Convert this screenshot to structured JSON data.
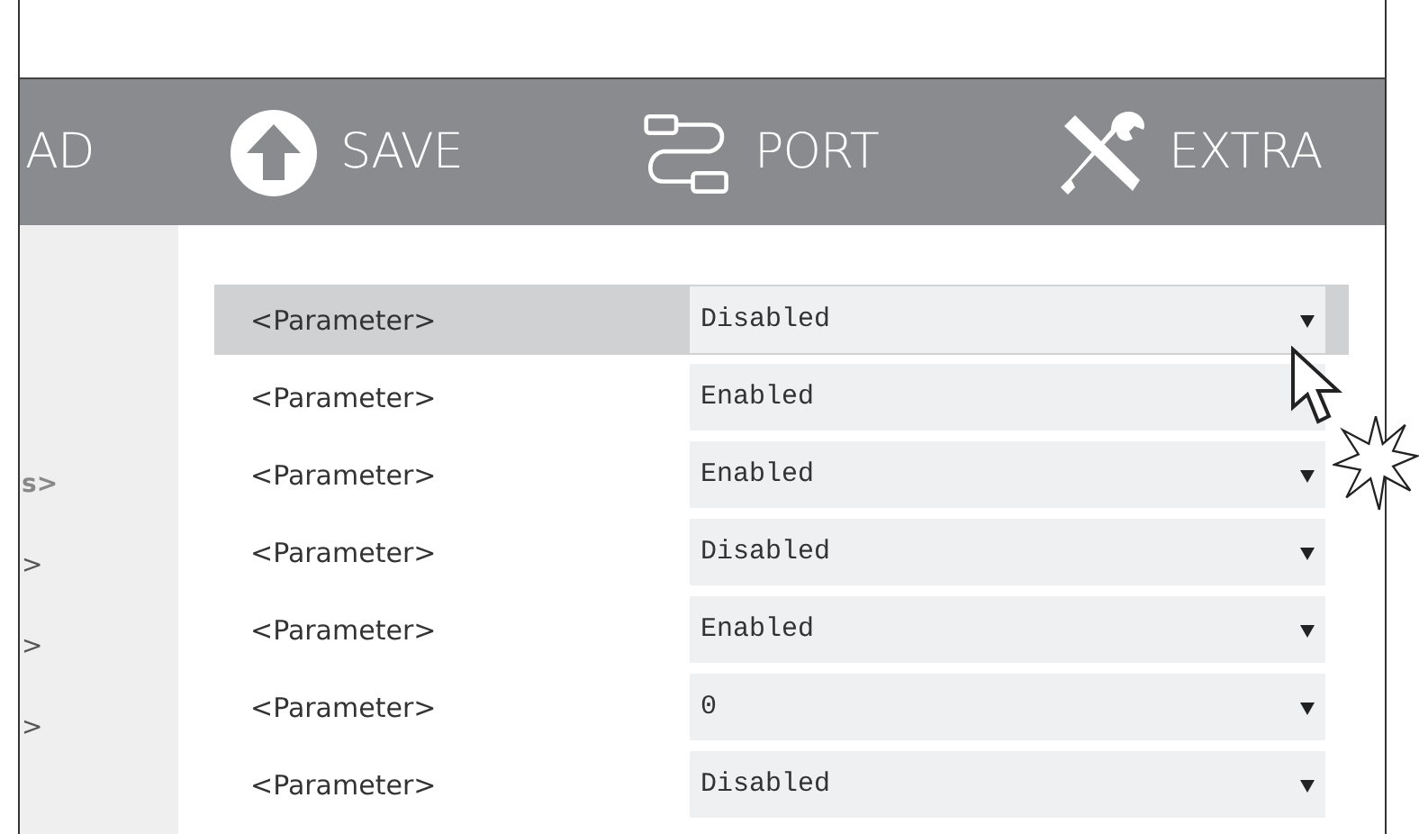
{
  "toolbar": [
    {
      "label": "AD",
      "kind": "text"
    },
    {
      "label": "SAVE",
      "kind": "upload"
    },
    {
      "label": "PORT",
      "kind": "cable"
    },
    {
      "label": "EXTRA",
      "kind": "tools"
    }
  ],
  "sidebar": {
    "items": [
      {
        "label": "s>",
        "bold": true
      },
      {
        "label": ">",
        "bold": false
      },
      {
        "label": ">",
        "bold": false
      },
      {
        "label": ">",
        "bold": false
      }
    ]
  },
  "rows": [
    {
      "label": "<Parameter>",
      "value": "Disabled",
      "selected": true,
      "arrow": true
    },
    {
      "label": "<Parameter>",
      "value": "Enabled",
      "selected": false,
      "arrow": false
    },
    {
      "label": "<Parameter>",
      "value": "Enabled",
      "selected": false,
      "arrow": true
    },
    {
      "label": "<Parameter>",
      "value": "Disabled",
      "selected": false,
      "arrow": true
    },
    {
      "label": "<Parameter>",
      "value": "Enabled",
      "selected": false,
      "arrow": true
    },
    {
      "label": "<Parameter>",
      "value": "0",
      "selected": false,
      "arrow": true
    },
    {
      "label": "<Parameter>",
      "value": "Disabled",
      "selected": false,
      "arrow": true
    }
  ]
}
